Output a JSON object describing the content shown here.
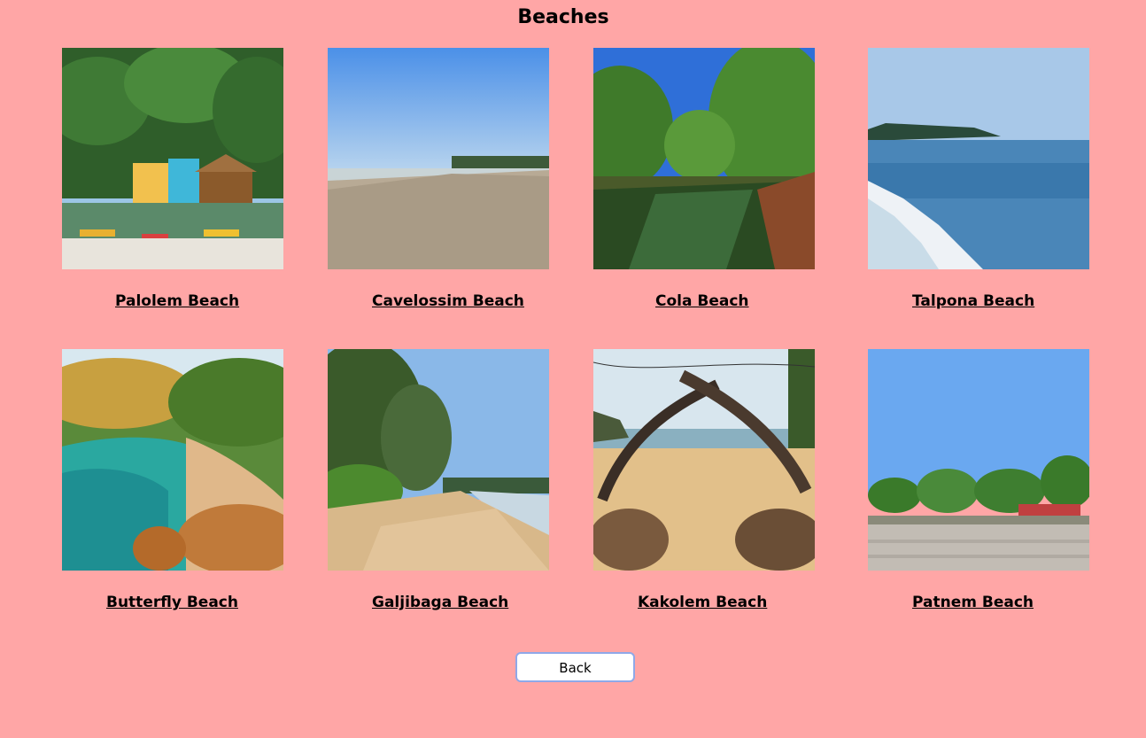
{
  "page": {
    "title": "Beaches",
    "background_color": "#ffa6a6"
  },
  "beaches": [
    {
      "name": "Palolem Beach",
      "image": "palm-beach-huts-image"
    },
    {
      "name": "Cavelossim Beach",
      "image": "long-sandy-shoreline-image"
    },
    {
      "name": "Cola Beach",
      "image": "palm-lagoon-image"
    },
    {
      "name": "Talpona Beach",
      "image": "sea-waves-headland-image"
    },
    {
      "name": "Butterfly Beach",
      "image": "cove-rocks-aerial-image"
    },
    {
      "name": "Galjibaga Beach",
      "image": "casuarina-trees-beach-image"
    },
    {
      "name": "Kakolem Beach",
      "image": "driftwood-arch-beach-image"
    },
    {
      "name": "Patnem Beach",
      "image": "rippled-sand-palms-image"
    }
  ],
  "back_button": {
    "label": "Back",
    "border_color": "#8fa8e8"
  }
}
